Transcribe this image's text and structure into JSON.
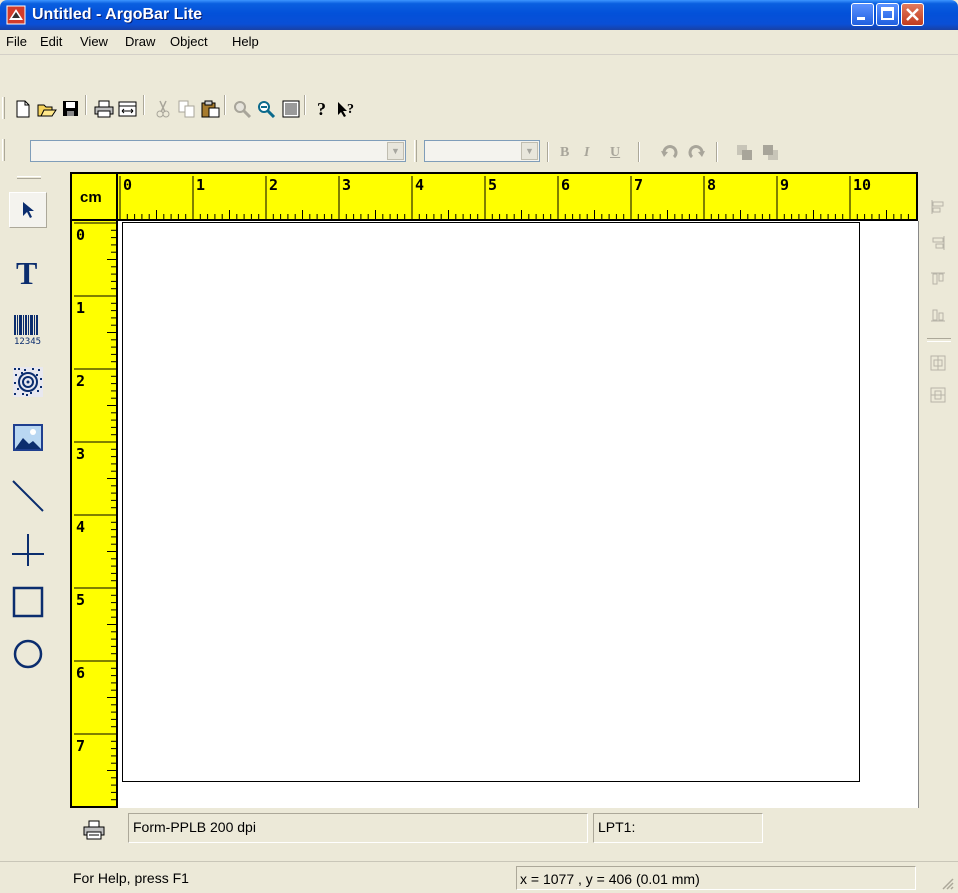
{
  "window": {
    "title": "Untitled - ArgoBar Lite"
  },
  "menu": [
    "File",
    "Edit",
    "View",
    "Draw",
    "Object",
    "Help"
  ],
  "toolbar": {
    "standard": [
      "new-icon",
      "open-icon",
      "save-icon",
      "print-icon",
      "page-setup-icon",
      "cut-icon",
      "copy-icon",
      "paste-icon",
      "zoom-in-icon",
      "zoom-out-icon",
      "grid-icon",
      "help-icon",
      "context-help-icon"
    ],
    "format": {
      "bold": "B",
      "italic": "I",
      "underline": "U"
    }
  },
  "tools": [
    "select-pointer-icon",
    "text-tool-icon",
    "barcode-tool-icon",
    "2d-barcode-tool-icon",
    "image-tool-icon",
    "line-tool-icon",
    "cross-tool-icon",
    "rectangle-tool-icon",
    "ellipse-tool-icon"
  ],
  "tools_barcode_digits": "12345",
  "ruler": {
    "unit": "cm",
    "h_numbers": [
      "0",
      "1",
      "2",
      "3",
      "4",
      "5",
      "6",
      "7",
      "8",
      "9",
      "10"
    ],
    "v_numbers": [
      "0",
      "1",
      "2",
      "3",
      "4",
      "5",
      "6",
      "7"
    ]
  },
  "bottom": {
    "printer_form": "Form-PPLB 200 dpi",
    "port": "LPT1:"
  },
  "status": {
    "help": "For Help, press F1",
    "coords": "x = 1077 , y = 406   (0.01 mm)"
  },
  "colors": {
    "ruler": "#ffff00",
    "titlebar": "#0351d9",
    "chrome": "#ece9d8"
  }
}
